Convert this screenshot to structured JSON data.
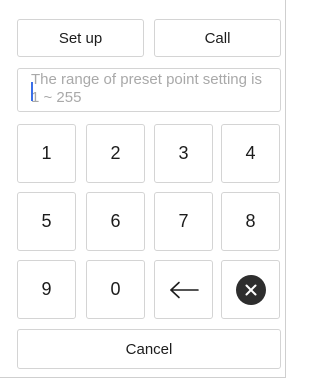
{
  "top_buttons": {
    "setup_label": "Set up",
    "call_label": "Call"
  },
  "preset_input": {
    "value": "",
    "placeholder": "The range of preset point setting is 1 ~ 255"
  },
  "keypad": {
    "keys": [
      "1",
      "2",
      "3",
      "4",
      "5",
      "6",
      "7",
      "8",
      "9",
      "0"
    ],
    "backspace_icon": "arrow-left-icon",
    "clear_icon": "clear-circle-x-icon"
  },
  "cancel_label": "Cancel",
  "colors": {
    "border": "#d4d4d4",
    "placeholder": "#a9a9a9",
    "caret": "#3b6fe8",
    "clear_icon_bg": "#2e2e2e"
  }
}
